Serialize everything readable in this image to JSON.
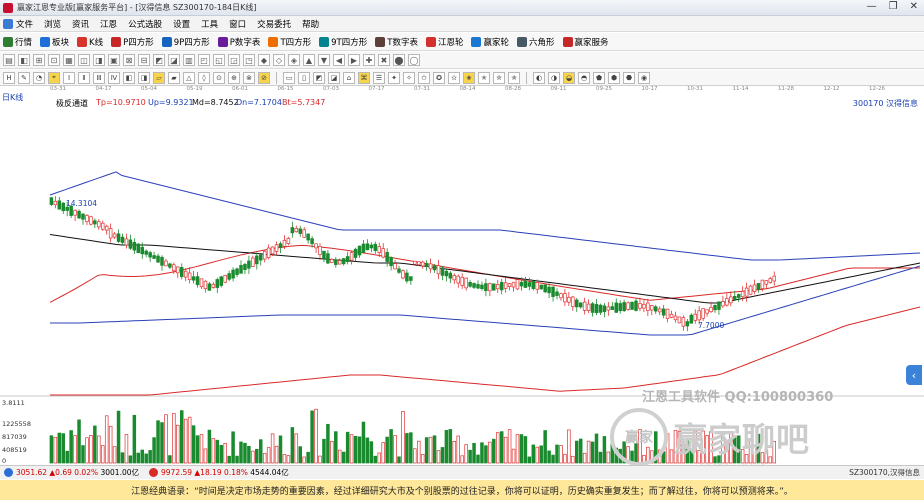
{
  "window": {
    "title": "赢家江恩专业版[赢家服务平台] - [汉得信息  SZ300170-184日K线]",
    "buttons": [
      "—",
      "❐",
      "✕"
    ]
  },
  "menu": [
    "文件",
    "浏览",
    "资讯",
    "江恩",
    "公式选股",
    "设置",
    "工具",
    "窗口",
    "交易委托",
    "帮助"
  ],
  "toolbar": [
    "行情",
    "板块",
    "K线",
    "P四方形",
    "9P四方形",
    "P数字表",
    "T四方形",
    "9T四方形",
    "T数字表",
    "江恩轮",
    "赢家轮",
    "六角形",
    "赢家服务"
  ],
  "toolbar_icon_colors": [
    "#2f7d32",
    "#1e6fd9",
    "#d9342b",
    "#c62828",
    "#1565c0",
    "#6a1b9a",
    "#ef6c00",
    "#00838f",
    "#5d4037",
    "#d32f2f",
    "#1976d2",
    "#455a64",
    "#c62828"
  ],
  "chart_header": {
    "period": "日K线",
    "indicator": "极反通道",
    "tp": "Tp=10.9710",
    "up": "Up=9.9321",
    "md": "Md=8.7452",
    "dn": "Dn=7.1704",
    "bt": "Bt=5.7347",
    "stock": "300170  汉得信息"
  },
  "date_ticks": [
    "03-31",
    "04-17",
    "05-04",
    "05-19",
    "06-01",
    "06-15",
    "07-03",
    "07-17",
    "07-31",
    "08-14",
    "08-28",
    "09-11",
    "09-25",
    "10-17",
    "10-31",
    "11-14",
    "11-28",
    "12-12",
    "12-26"
  ],
  "annotations": {
    "high": "14.3104",
    "low": "7.7000"
  },
  "volume_axis": [
    "3.8111",
    "1225558",
    "817039",
    "408519",
    "0"
  ],
  "watermark": {
    "line1": "江恩工具软件  QQ:100800360",
    "logo": "赢家",
    "brand": "赢家聊吧",
    "url": "liaoba.yingjia..."
  },
  "status": {
    "sh_index": "3051.62",
    "sh_change": "▲0.69",
    "sh_pct": "0.02%",
    "sh_amount": "3001.00亿",
    "sz_index": "9972.59",
    "sz_change": "▲18.19",
    "sz_pct": "0.18%",
    "sz_amount": "4544.04亿",
    "right": "SZ300170,汉得信息"
  },
  "quote": "江恩经典语录：“时间是决定市场走势的重要因素，经过详细研究大市及个别股票的过往记录，你将可以证明，历史确实重复发生；而了解过往，你将可以预测将来。”。",
  "colors": {
    "up_candle": "#e23333",
    "down_candle": "#1a8a2e",
    "upper_band": "#d92a2a",
    "mid_band": "#2a3fb8",
    "middle_line": "#111111"
  },
  "chart_data": {
    "type": "candlestick",
    "title": "极反通道",
    "series": [
      {
        "name": "Tp",
        "last": 10.971
      },
      {
        "name": "Up",
        "last": 9.9321
      },
      {
        "name": "Md",
        "last": 8.7452
      },
      {
        "name": "Dn",
        "last": 7.1704
      },
      {
        "name": "Bt",
        "last": 5.7347
      }
    ],
    "price_range": [
      7.7,
      14.3104
    ],
    "volume_max": 1225558
  }
}
